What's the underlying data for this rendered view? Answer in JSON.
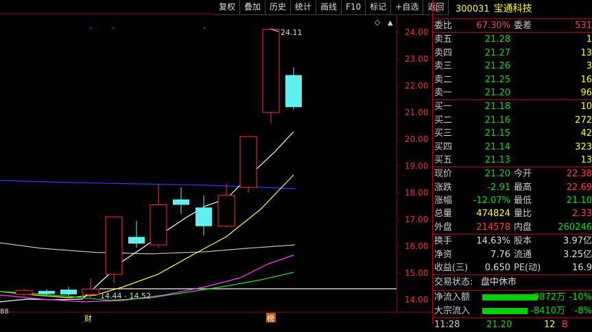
{
  "toolbar": {
    "buttons": [
      "复权",
      "叠加",
      "历史",
      "统计",
      "画线",
      "F10",
      "标记",
      "+自选",
      "返回"
    ]
  },
  "stock": {
    "flag": "L",
    "code": "300031",
    "name": "宝通科技"
  },
  "ratio": {
    "wb_label": "委比",
    "wb_value": "67.30%",
    "wc_label": "委差",
    "wc_value": "531"
  },
  "asks": [
    {
      "label": "卖五",
      "price": "21.28",
      "vol": "1"
    },
    {
      "label": "卖四",
      "price": "21.27",
      "vol": "13"
    },
    {
      "label": "卖三",
      "price": "21.26",
      "vol": "3"
    },
    {
      "label": "卖二",
      "price": "21.25",
      "vol": "16"
    },
    {
      "label": "卖一",
      "price": "21.20",
      "vol": "96"
    }
  ],
  "bids": [
    {
      "label": "买一",
      "price": "21.18",
      "vol": "10"
    },
    {
      "label": "买二",
      "price": "21.16",
      "vol": "272"
    },
    {
      "label": "买三",
      "price": "21.15",
      "vol": "42"
    },
    {
      "label": "买四",
      "price": "21.14",
      "vol": "323"
    },
    {
      "label": "买五",
      "price": "21.13",
      "vol": "13"
    }
  ],
  "quote": [
    {
      "l1": "现价",
      "v1": "21.20",
      "c1": "g",
      "l2": "今开",
      "v2": "22.38",
      "c2": "r"
    },
    {
      "l1": "涨跌",
      "v1": "-2.91",
      "c1": "g",
      "l2": "最高",
      "v2": "22.69",
      "c2": "r"
    },
    {
      "l1": "涨幅",
      "v1": "-12.07%",
      "c1": "g",
      "l2": "最低",
      "v2": "21.10",
      "c2": "g"
    },
    {
      "l1": "总量",
      "v1": "474824",
      "c1": "y",
      "l2": "量比",
      "v2": "2.33",
      "c2": "r"
    },
    {
      "l1": "外盘",
      "v1": "214578",
      "c1": "r",
      "l2": "内盘",
      "v2": "260246",
      "c2": "g"
    }
  ],
  "fund": [
    {
      "l1": "换手",
      "v1": "14.63%",
      "l2": "股本",
      "v2": "3.97亿"
    },
    {
      "l1": "净资",
      "v1": "7.76",
      "l2": "流通",
      "v2": "3.25亿"
    },
    {
      "l1": "收益(三)",
      "v1": "0.650",
      "l2": "PE(动)",
      "v2": "16.9"
    }
  ],
  "status": {
    "label": "交易状态:",
    "value": "盘中休市"
  },
  "flows": [
    {
      "label": "净流入额",
      "value": "-9872万",
      "pct": "-10%"
    },
    {
      "label": "大宗流入",
      "value": "-8410万",
      "pct": "-8%"
    }
  ],
  "tick": {
    "time": "11:28",
    "price": "21.20",
    "vol": "12",
    "side": "B"
  },
  "chart_data": {
    "type": "candlestick",
    "y_ticks": [
      "24.00",
      "23.00",
      "22.00",
      "21.00",
      "20.00",
      "19.00",
      "18.00",
      "17.00",
      "16.00",
      "15.00",
      "14.00"
    ],
    "ylim": [
      13.6,
      24.5
    ],
    "candles": [
      {
        "o": 14.2,
        "c": 14.35,
        "h": 14.4,
        "l": 14.05
      },
      {
        "o": 14.33,
        "c": 14.22,
        "h": 14.4,
        "l": 14.18
      },
      {
        "o": 14.38,
        "c": 14.2,
        "h": 14.48,
        "l": 14.15
      },
      {
        "o": 14.2,
        "c": 14.4,
        "h": 14.8,
        "l": 14.05
      },
      {
        "o": 14.95,
        "c": 17.1,
        "h": 17.1,
        "l": 14.62
      },
      {
        "o": 16.35,
        "c": 16.1,
        "h": 16.95,
        "l": 15.95
      },
      {
        "o": 16.05,
        "c": 17.55,
        "h": 18.3,
        "l": 15.95
      },
      {
        "o": 17.75,
        "c": 17.55,
        "h": 18.2,
        "l": 17.2
      },
      {
        "o": 17.45,
        "c": 16.75,
        "h": 17.9,
        "l": 16.4
      },
      {
        "o": 16.75,
        "c": 17.9,
        "h": 18.35,
        "l": 16.7
      },
      {
        "o": 18.2,
        "c": 20.1,
        "h": 20.1,
        "l": 18.0
      },
      {
        "o": 21.0,
        "c": 24.11,
        "h": 24.11,
        "l": 20.6
      },
      {
        "o": 22.4,
        "c": 21.2,
        "h": 22.69,
        "l": 21.1
      }
    ],
    "high_label": "24.11",
    "range_label": "14.44 - 14.52",
    "left_tick": "88",
    "markers": [
      "财",
      "榜"
    ]
  }
}
